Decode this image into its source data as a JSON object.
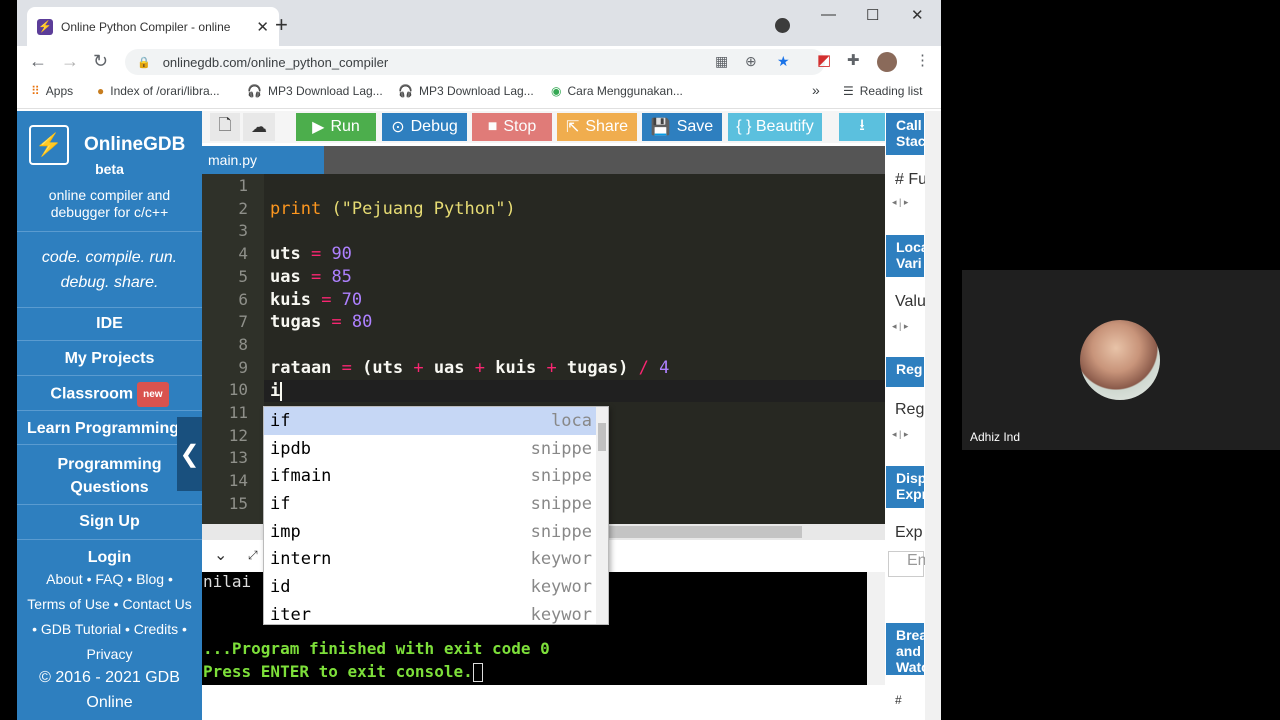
{
  "browser": {
    "tab_title": "Online Python Compiler - online",
    "tab_close": "✕",
    "new_tab": "+",
    "url": "onlinegdb.com/online_python_compiler",
    "window_controls": {
      "minimize": "—",
      "maximize": "☐",
      "close": "✕"
    },
    "bookmarks": [
      {
        "label": "Apps",
        "icon": "apps-grid-icon"
      },
      {
        "label": "Index of /orari/libra...",
        "icon": "bookmark-favicon-icon"
      },
      {
        "label": "MP3 Download Lag...",
        "icon": "headphones-icon"
      },
      {
        "label": "MP3 Download Lag...",
        "icon": "headphones-icon"
      },
      {
        "label": "Cara Menggunakan...",
        "icon": "bookmark-favicon-icon"
      }
    ],
    "bookmarks_overflow": "»",
    "reading_list": "Reading list"
  },
  "sidebar": {
    "logo_glyph": "⚡",
    "brand": "OnlineGDB",
    "beta": "beta",
    "tagline": "online compiler and debugger for c/c++",
    "motto_line1": "code. compile. run.",
    "motto_line2": "debug. share.",
    "nav": {
      "ide": "IDE",
      "my_projects": "My Projects",
      "classroom": "Classroom",
      "new_badge": "new",
      "learn": "Learn Programming",
      "questions_line1": "Programming",
      "questions_line2": "Questions",
      "signup": "Sign Up",
      "login": "Login"
    },
    "collapse_glyph": "❮",
    "footer": {
      "line1": "About • FAQ • Blog •",
      "line2": "Terms of Use • Contact Us",
      "line3": "• GDB Tutorial • Credits •",
      "line4": "Privacy",
      "copy1": "© 2016 - 2021 GDB",
      "copy2": "Online"
    }
  },
  "toolbar": {
    "run": "Run",
    "debug": "Debug",
    "stop": "Stop",
    "share": "Share",
    "save": "Save",
    "beautify": "{ } Beautify"
  },
  "editor": {
    "file_tab": "main.py",
    "line_numbers": [
      "1",
      "2",
      "3",
      "4",
      "5",
      "6",
      "7",
      "8",
      "9",
      "10",
      "11",
      "12",
      "13",
      "14",
      "15"
    ],
    "code": {
      "l2_fn": "print",
      "l2_str": "(\"Pejuang Python\")",
      "l4_var": "uts",
      "l4_val": "90",
      "l5_var": "uas",
      "l5_val": "85",
      "l6_var": "kuis",
      "l6_val": "70",
      "l7_var": "tugas",
      "l7_val": "80",
      "l9_var": "rataan",
      "l10": "i"
    }
  },
  "autocomplete": [
    {
      "word": "if",
      "type": "loca"
    },
    {
      "word": "ipdb",
      "type": "snippe"
    },
    {
      "word": "ifmain",
      "type": "snippe"
    },
    {
      "word": "if",
      "type": "snippe"
    },
    {
      "word": "imp",
      "type": "snippe"
    },
    {
      "word": "intern",
      "type": "keywor"
    },
    {
      "word": "id",
      "type": "keywor"
    },
    {
      "word": "iter",
      "type": "keywor"
    }
  ],
  "console": {
    "line1": "nilai",
    "line2": "...Program finished with exit code 0",
    "line3": "Press ENTER to exit console."
  },
  "right_panel": {
    "call_stack": "Call Stack",
    "functions": "# Fu",
    "local_vars": "Local Vari",
    "value": "Valu",
    "registers": "Reg",
    "reg_col": "Reg",
    "display_expr": "Disp Expr",
    "expr": "Exp",
    "expr_input": "En",
    "breakpoints": "Brea and Watc",
    "bp_col": "#"
  },
  "meeting": {
    "participant_name": "Adhiz Ind"
  },
  "colors": {
    "brand_blue": "#2e7fbf",
    "run_green": "#4cae4c",
    "stop_red": "#d9534f",
    "share_orange": "#f0ad4e",
    "console_green": "#7ddf3a"
  }
}
